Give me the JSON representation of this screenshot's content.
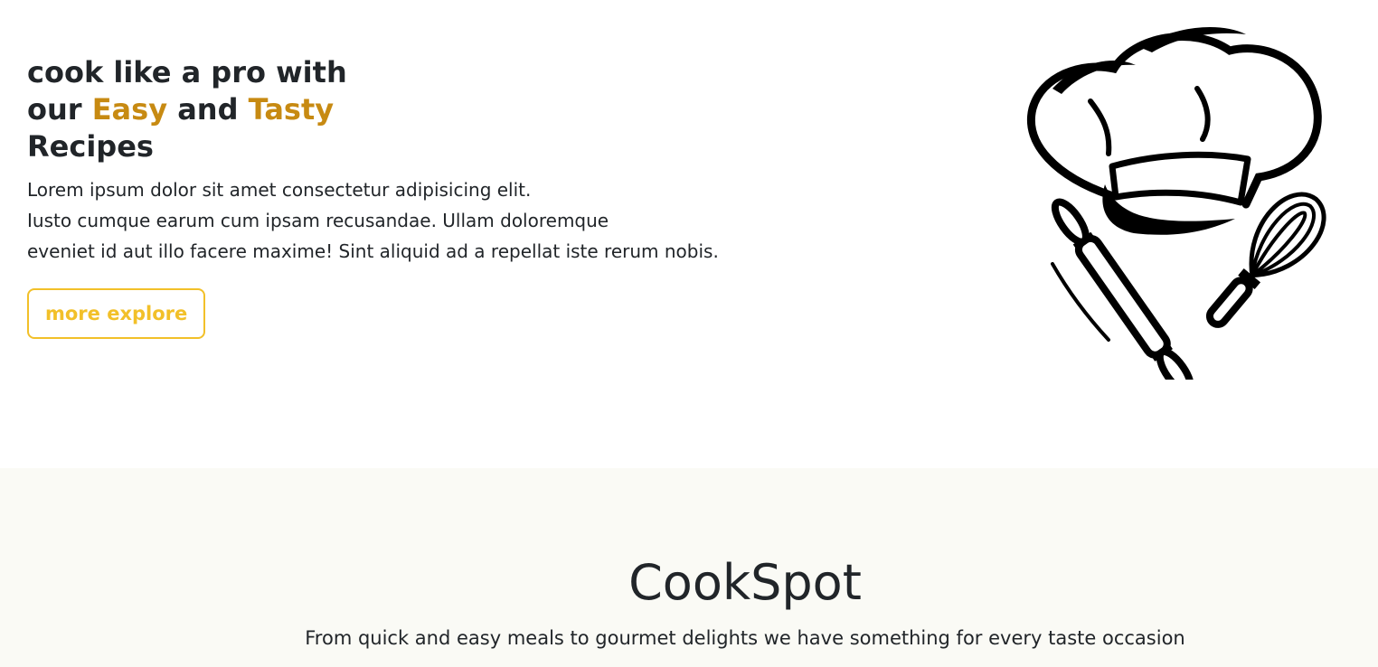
{
  "hero": {
    "headline": {
      "line1": "cook like a pro with",
      "line2_prefix": "our ",
      "accent1": "Easy",
      "line2_middle": " and ",
      "accent2": "Tasty",
      "line3": "Recipes"
    },
    "description": [
      "Lorem ipsum dolor sit amet consectetur adipisicing elit.",
      "Iusto cumque earum cum ipsam recusandae. Ullam doloremque",
      "eveniet id aut illo facere maxime! Sint aliquid ad a repellat iste rerum nobis."
    ],
    "cta_label": "more explore",
    "logo_icon": "chef-hat-rolling-pin-whisk-icon"
  },
  "brand_section": {
    "title": "CookSpot",
    "tagline": "From quick and easy meals to gourmet delights we have something for every taste occasion"
  },
  "colors": {
    "accent_text": "#c78a12",
    "button_accent": "#f2c029",
    "text": "#212529",
    "section_bg": "#fafaf5"
  }
}
